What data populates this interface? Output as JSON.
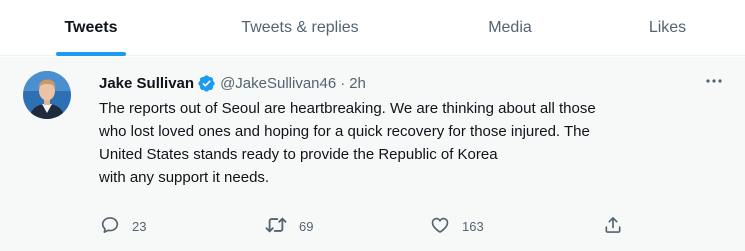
{
  "tabs": [
    {
      "label": "Tweets",
      "active": true
    },
    {
      "label": "Tweets & replies",
      "active": false
    },
    {
      "label": "Media",
      "active": false
    },
    {
      "label": "Likes",
      "active": false
    }
  ],
  "tweet": {
    "author_name": "Jake Sullivan",
    "handle": "@JakeSullivan46",
    "separator": "·",
    "time": "2h",
    "text_lines": [
      "The reports out of Seoul are heartbreaking. We are thinking about all those",
      "who lost loved ones and hoping for a quick recovery for those injured. The",
      "United States stands ready to provide the Republic of Korea",
      "with any support it needs."
    ],
    "replies": "23",
    "retweets": "69",
    "likes": "163"
  },
  "colors": {
    "accent": "#1d9bf0",
    "text_primary": "#0f1419",
    "text_secondary": "#536471",
    "tweet_background": "#f7f9f9"
  },
  "icons": [
    "verified-badge-icon",
    "more-options-icon",
    "reply-icon",
    "retweet-icon",
    "like-icon",
    "share-icon"
  ]
}
